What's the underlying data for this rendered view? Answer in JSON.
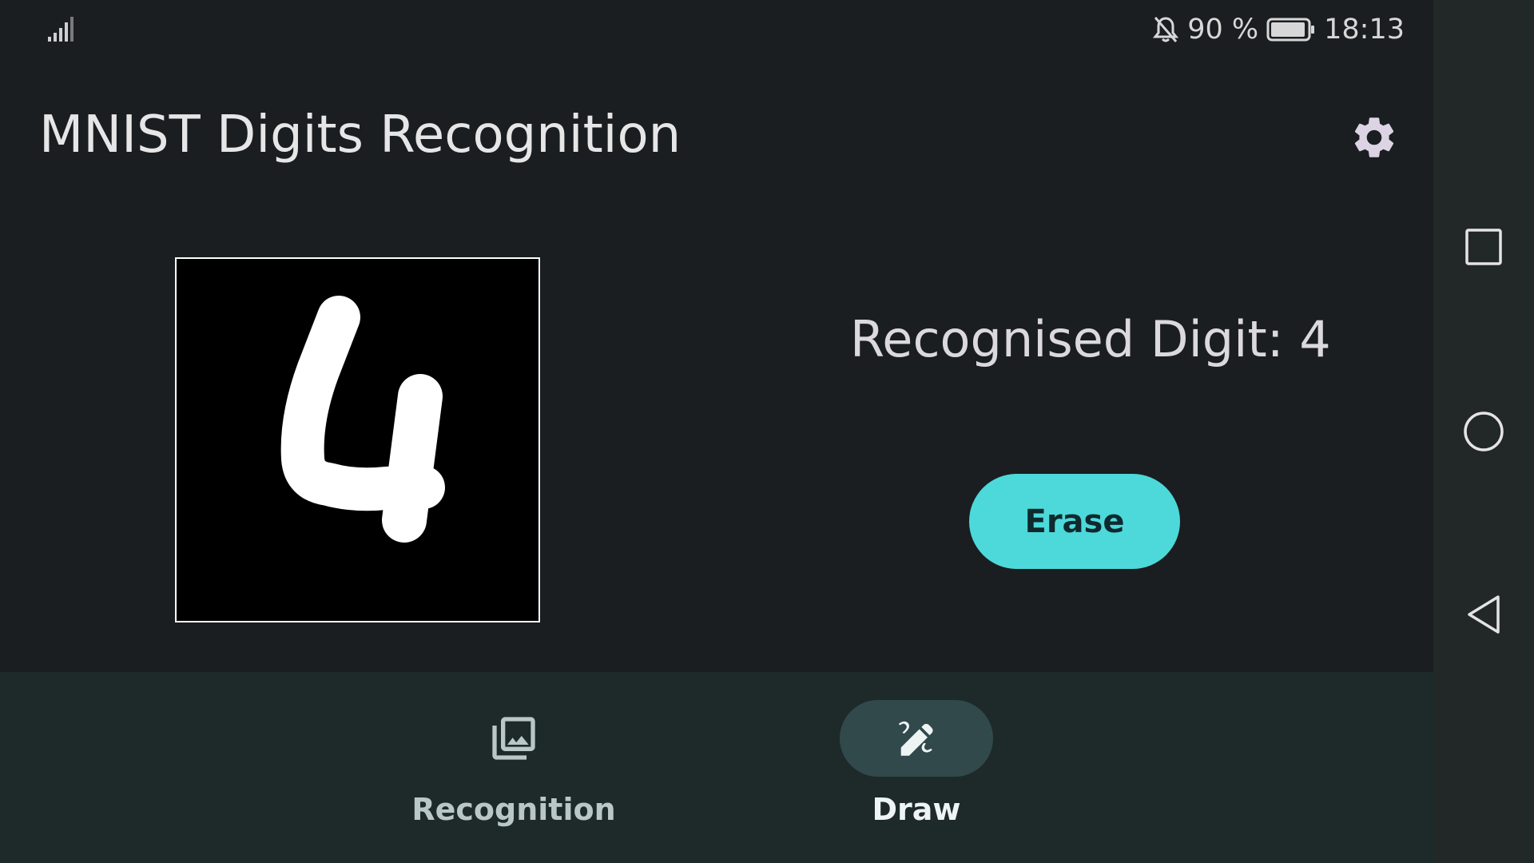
{
  "status_bar": {
    "battery_percent": "90 %",
    "time": "18:13",
    "icons": [
      "signal-icon",
      "bell-off-icon",
      "battery-icon"
    ]
  },
  "header": {
    "title": "MNIST Digits Recognition",
    "settings_icon": "gear-icon"
  },
  "canvas": {
    "drawn_digit": "4"
  },
  "result": {
    "text": "Recognised Digit: 4"
  },
  "actions": {
    "erase_label": "Erase"
  },
  "bottom_nav": {
    "items": [
      {
        "label": "Recognition",
        "icon": "image-library-icon",
        "active": false
      },
      {
        "label": "Draw",
        "icon": "draw-icon",
        "active": true
      }
    ]
  },
  "system_nav": {
    "buttons": [
      "recents-icon",
      "home-icon",
      "back-icon"
    ]
  },
  "colors": {
    "background": "#1a1e20",
    "accent": "#4dd8d9",
    "nav_background": "#1e2a2a",
    "active_pill": "#31494b"
  }
}
